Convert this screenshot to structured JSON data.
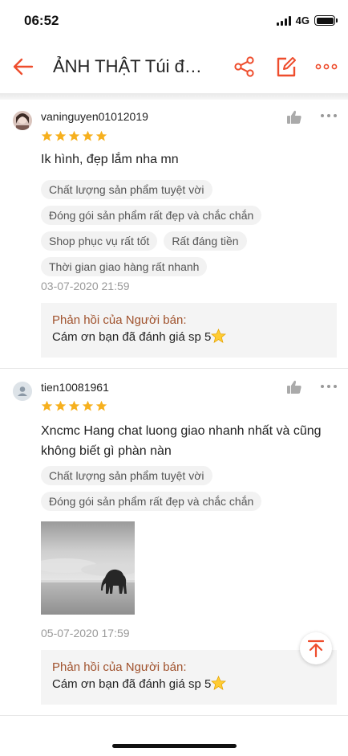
{
  "status": {
    "time": "06:52",
    "network": "4G",
    "battery_level": 1.0
  },
  "header": {
    "title": "ẢNH THẬT Túi đ…"
  },
  "colors": {
    "accent": "#ee4d2d",
    "star": "#f6b01e",
    "reply_title": "#a0522d"
  },
  "reviews": [
    {
      "username": "vaninguyen01012019",
      "rating": 5,
      "text": "Ik hình, đẹp lắm nha mn",
      "tags": [
        "Chất lượng sản phẩm tuyệt vời",
        "Đóng gói sản phẩm rất đẹp và chắc chắn",
        "Shop phục vụ rất tốt",
        "Rất đáng tiền",
        "Thời gian giao hàng rất nhanh"
      ],
      "date": "03-07-2020 21:59",
      "reply": {
        "title": "Phản hồi của Người bán:",
        "text": "Cám ơn bạn đã đánh giá sp 5"
      }
    },
    {
      "username": "tien10081961",
      "rating": 5,
      "text": "Xncmc Hang chat luong giao nhanh nhất và cũng không biết gì phàn nàn",
      "tags": [
        "Chất lượng sản phẩm tuyệt vời",
        "Đóng gói sản phẩm rất đẹp và chắc chắn"
      ],
      "date": "05-07-2020 17:59",
      "reply": {
        "title": "Phản hồi của Người bán:",
        "text": "Cám ơn bạn đã đánh giá sp 5"
      }
    }
  ],
  "icons": {
    "back": "arrow-left-icon",
    "share": "share-icon",
    "edit": "edit-icon",
    "more": "more-dots-icon",
    "like": "thumbs-up-icon",
    "scroll_top": "scroll-to-top-icon"
  }
}
